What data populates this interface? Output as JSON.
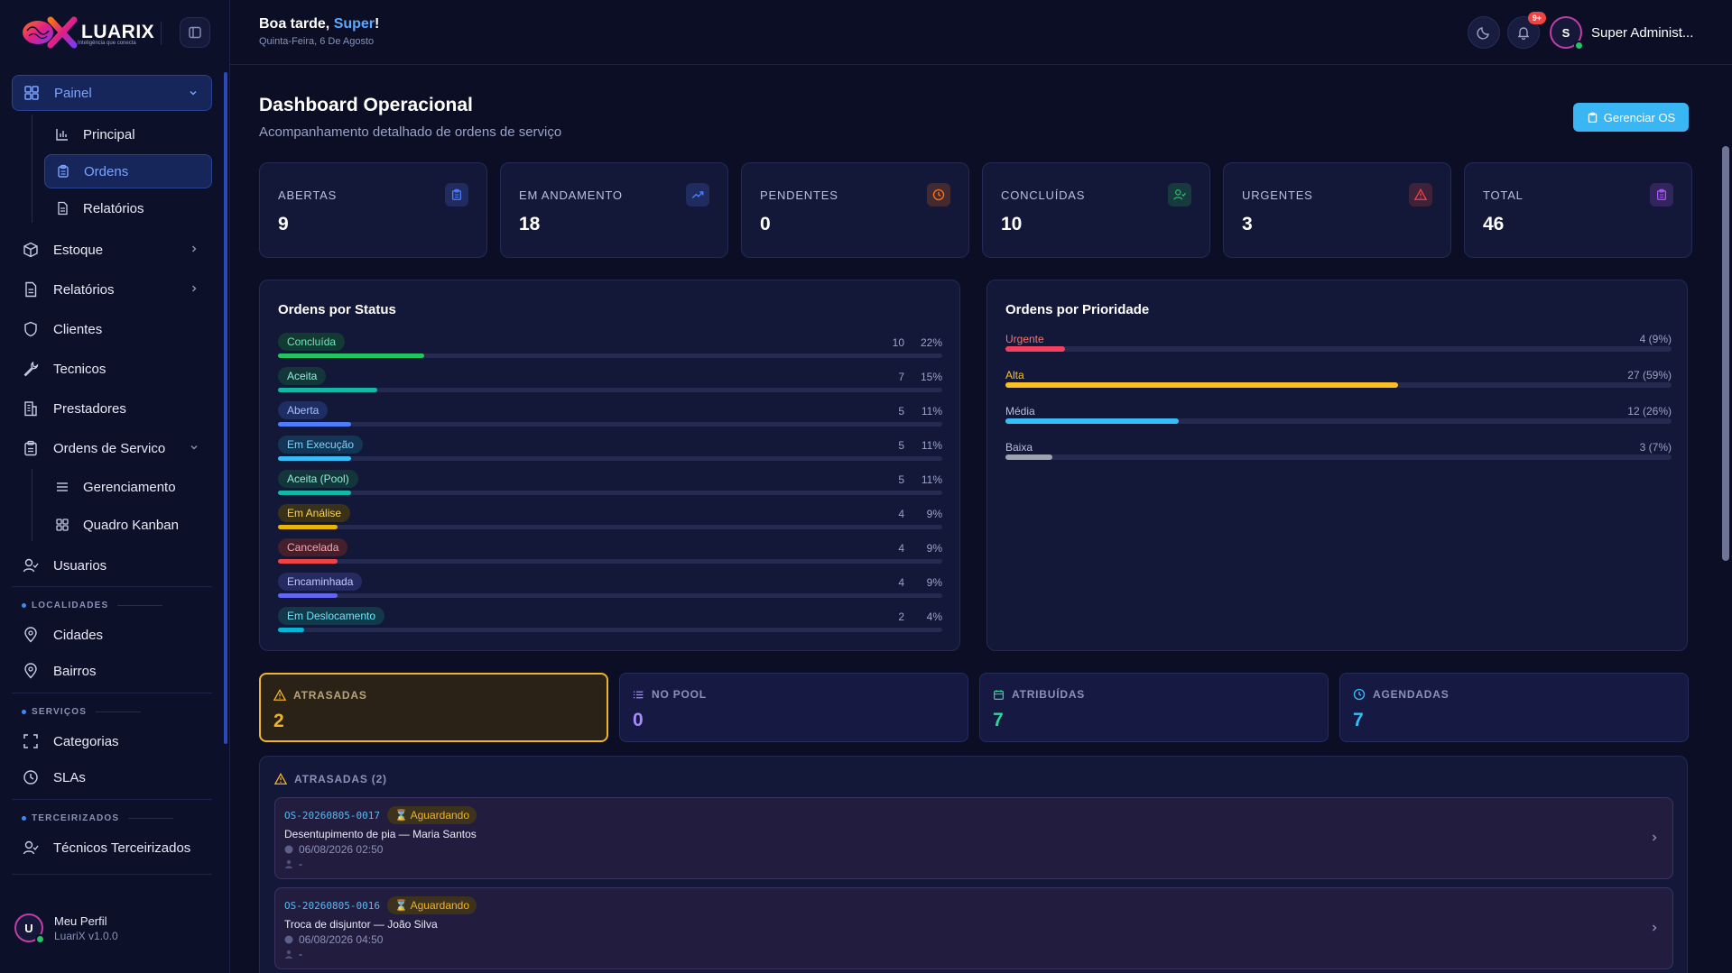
{
  "brand": {
    "name": "LUARIX",
    "tagline": "Inteligência que conecta"
  },
  "colors": {
    "accent": "#3ab6f5",
    "active_nav": "#7aa4ff",
    "warning": "#f0b429",
    "danger": "#ef4444",
    "success": "#22c55e"
  },
  "sidebar": {
    "painel": "Painel",
    "principal": "Principal",
    "ordens": "Ordens",
    "relatorios_sub": "Relatórios",
    "estoque": "Estoque",
    "relatorios": "Relatórios",
    "clientes": "Clientes",
    "tecnicos": "Tecnicos",
    "prestadores": "Prestadores",
    "ordens_servico": "Ordens de Servico",
    "gerenciamento": "Gerenciamento",
    "kanban": "Quadro Kanban",
    "usuarios": "Usuarios",
    "sec_localidades": "LOCALIDADES",
    "cidades": "Cidades",
    "bairros": "Bairros",
    "sec_servicos": "SERVIÇOS",
    "categorias": "Categorias",
    "slas": "SLAs",
    "sec_terceirizados": "TERCEIRIZADOS",
    "tecnicos_terceirizados": "Técnicos Terceirizados"
  },
  "profile": {
    "initial": "U",
    "name": "Meu Perfil",
    "version": "LuariX v1.0.0"
  },
  "topbar": {
    "greeting_prefix": "Boa tarde, ",
    "greeting_name": "Super",
    "greeting_suffix": "!",
    "date": "Quinta-Feira, 6 De Agosto",
    "notif_badge": "9+",
    "user_initial": "S",
    "user_name": "Super Administ..."
  },
  "header": {
    "title": "Dashboard Operacional",
    "subtitle": "Acompanhamento detalhado de ordens de serviço",
    "manage_button": "Gerenciar OS"
  },
  "stats": [
    {
      "label": "ABERTAS",
      "value": "9",
      "icon": "clipboard-icon",
      "color": "#4f7cff"
    },
    {
      "label": "EM ANDAMENTO",
      "value": "18",
      "icon": "trend-up-icon",
      "color": "#4f7cff"
    },
    {
      "label": "PENDENTES",
      "value": "0",
      "icon": "clock-icon",
      "color": "#f97316"
    },
    {
      "label": "CONCLUÍDAS",
      "value": "10",
      "icon": "user-check-icon",
      "color": "#22c55e"
    },
    {
      "label": "URGENTES",
      "value": "3",
      "icon": "alert-triangle-icon",
      "color": "#ef4444"
    },
    {
      "label": "TOTAL",
      "value": "46",
      "icon": "clipboard-list-icon",
      "color": "#a855f7"
    }
  ],
  "status_panel": {
    "title": "Ordens por Status",
    "rows": [
      {
        "label": "Concluída",
        "count": "10",
        "pct": "22%",
        "fraction": 0.22,
        "color": "#22c55e",
        "pill_bg": "#123a33",
        "pill_fg": "#6ee7b7"
      },
      {
        "label": "Aceita",
        "count": "7",
        "pct": "15%",
        "fraction": 0.15,
        "color": "#14b8a6",
        "pill_bg": "#12363a",
        "pill_fg": "#8ef0d6"
      },
      {
        "label": "Aberta",
        "count": "5",
        "pct": "11%",
        "fraction": 0.11,
        "color": "#4f7cff",
        "pill_bg": "#1e2d64",
        "pill_fg": "#a9c0ff"
      },
      {
        "label": "Em Execução",
        "count": "5",
        "pct": "11%",
        "fraction": 0.11,
        "color": "#38bdf8",
        "pill_bg": "#143656",
        "pill_fg": "#7dd3fc"
      },
      {
        "label": "Aceita (Pool)",
        "count": "5",
        "pct": "11%",
        "fraction": 0.11,
        "color": "#14b8a6",
        "pill_bg": "#12363a",
        "pill_fg": "#8ef0d6"
      },
      {
        "label": "Em Análise",
        "count": "4",
        "pct": "9%",
        "fraction": 0.09,
        "color": "#eab308",
        "pill_bg": "#3a3218",
        "pill_fg": "#fcd34d"
      },
      {
        "label": "Cancelada",
        "count": "4",
        "pct": "9%",
        "fraction": 0.09,
        "color": "#ef4444",
        "pill_bg": "#43202c",
        "pill_fg": "#fda4af"
      },
      {
        "label": "Encaminhada",
        "count": "4",
        "pct": "9%",
        "fraction": 0.09,
        "color": "#6366f1",
        "pill_bg": "#262a62",
        "pill_fg": "#c4c8ff"
      },
      {
        "label": "Em Deslocamento",
        "count": "2",
        "pct": "4%",
        "fraction": 0.04,
        "color": "#06b6d4",
        "pill_bg": "#12384a",
        "pill_fg": "#67e8f9"
      }
    ]
  },
  "priority_panel": {
    "title": "Ordens por Prioridade",
    "rows": [
      {
        "label": "Urgente",
        "value": "4 (9%)",
        "fraction": 0.09,
        "color": "#f43f5e",
        "label_color": "#f87171"
      },
      {
        "label": "Alta",
        "value": "27 (59%)",
        "fraction": 0.59,
        "color": "#fbbf24",
        "label_color": "#fbbf24"
      },
      {
        "label": "Média",
        "value": "12 (26%)",
        "fraction": 0.26,
        "color": "#38bdf8",
        "label_color": "#b9bfdc"
      },
      {
        "label": "Baixa",
        "value": "3 (7%)",
        "fraction": 0.07,
        "color": "#9ca3af",
        "label_color": "#b9bfdc"
      }
    ]
  },
  "quick_cards": [
    {
      "label": "ATRASADAS",
      "value": "2",
      "icon": "alert-triangle-icon",
      "color": "#f0b429",
      "label_color": "#b9a37a"
    },
    {
      "label": "NO POOL",
      "value": "0",
      "icon": "list-icon",
      "color": "#a78bfa",
      "label_color": "#8a92b8"
    },
    {
      "label": "ATRIBUÍDAS",
      "value": "7",
      "icon": "calendar-icon",
      "color": "#34d399",
      "label_color": "#8a92b8"
    },
    {
      "label": "AGENDADAS",
      "value": "7",
      "icon": "clock-icon",
      "color": "#38bdf8",
      "label_color": "#8a92b8"
    }
  ],
  "late_list": {
    "title": "ATRASADAS (2)",
    "items": [
      {
        "code": "OS-20260805-0017",
        "status": "Aguardando",
        "desc": "Desentupimento de pia — Maria Santos",
        "date": "06/08/2026 02:50",
        "user": "-"
      },
      {
        "code": "OS-20260805-0016",
        "status": "Aguardando",
        "desc": "Troca de disjuntor — João Silva",
        "date": "06/08/2026 04:50",
        "user": "-"
      }
    ]
  }
}
